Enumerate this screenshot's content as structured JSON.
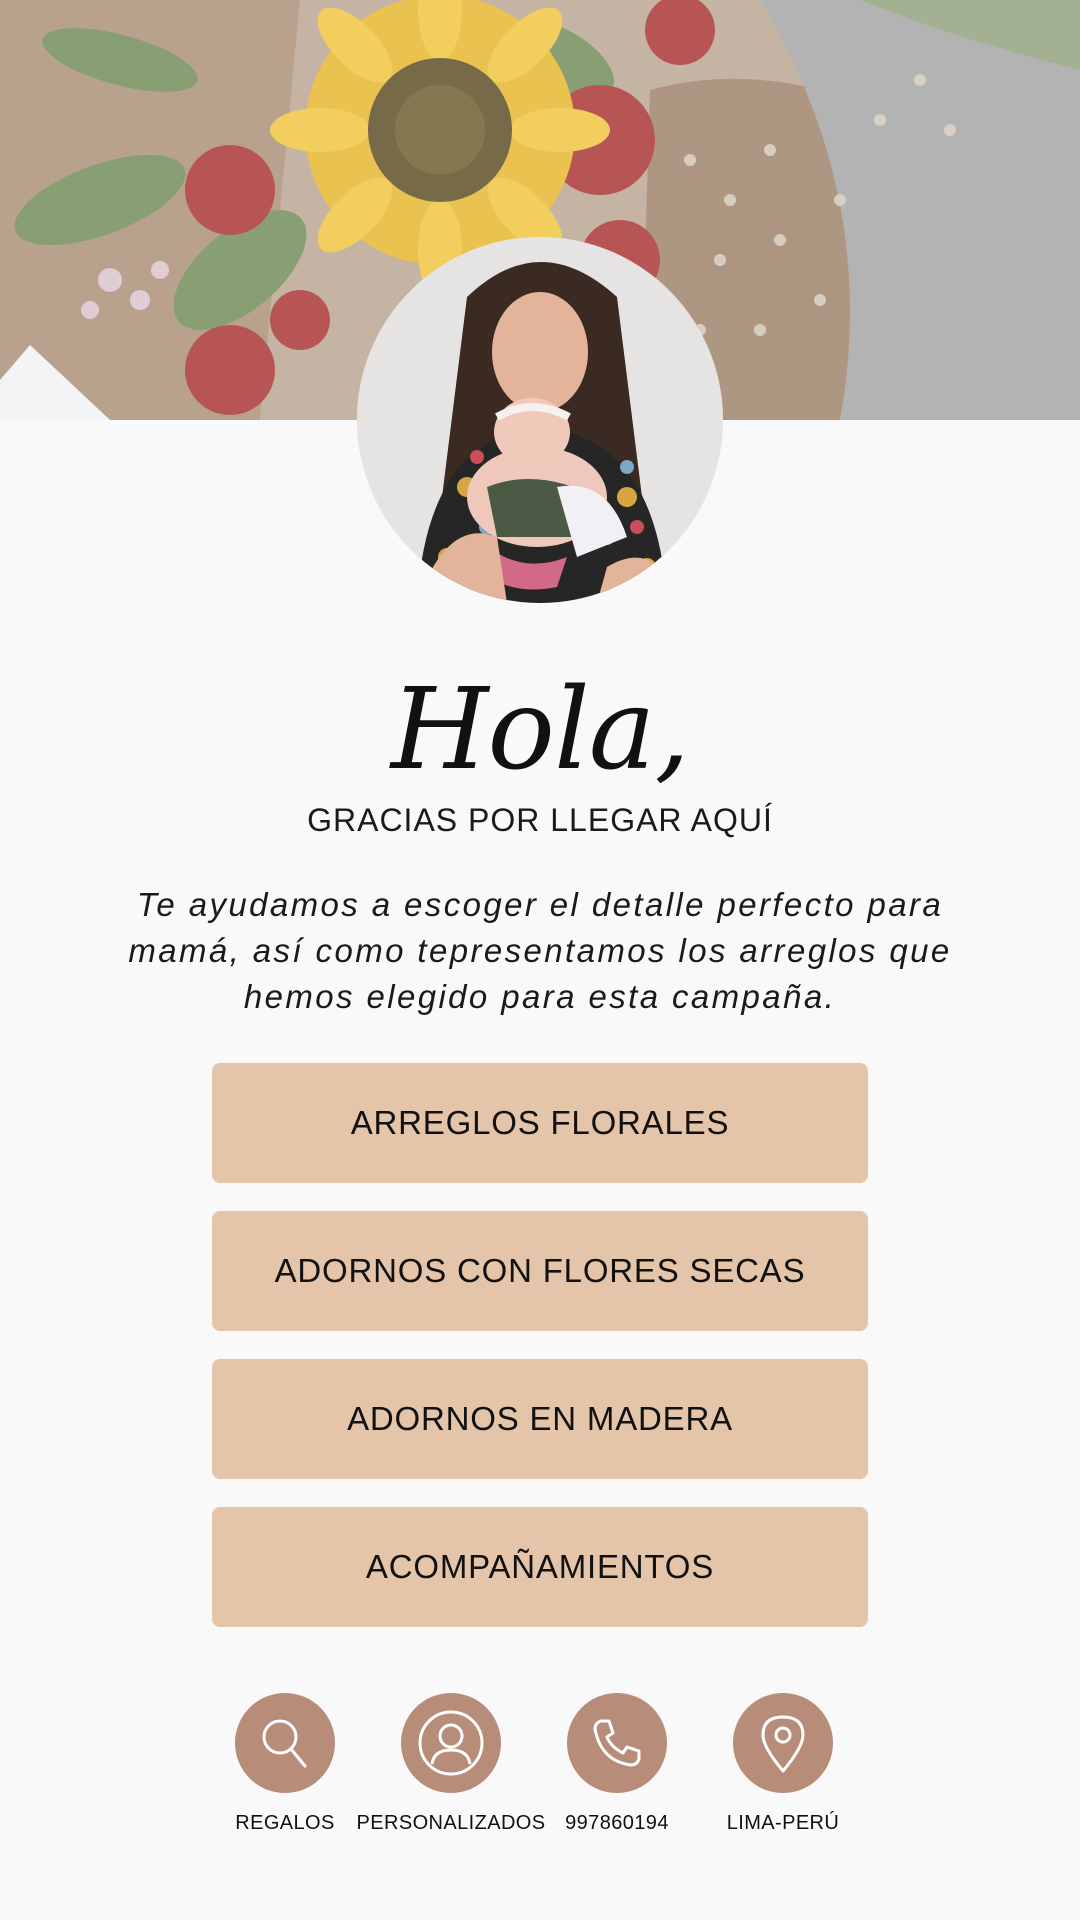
{
  "header": {
    "banner_image": "sunflower-bouquet-photo",
    "avatar_image": "mother-holding-newborn-photo"
  },
  "greeting": "Hola,",
  "subtitle": "GRACIAS POR LLEGAR AQUÍ",
  "intro": "Te ayudamos a escoger el detalle perfecto para mamá, así como tepresentamos los arreglos que hemos elegido para esta campaña.",
  "menu": {
    "items": [
      {
        "label": "ARREGLOS FLORALES"
      },
      {
        "label": "ADORNOS CON FLORES SECAS"
      },
      {
        "label": "ADORNOS EN MADERA"
      },
      {
        "label": "ACOMPAÑAMIENTOS"
      }
    ]
  },
  "footer": {
    "links": [
      {
        "label": "REGALOS",
        "icon": "search-icon"
      },
      {
        "label": "PERSONALIZADOS",
        "icon": "user-icon"
      },
      {
        "label": "997860194",
        "icon": "phone-icon"
      },
      {
        "label": "LIMA-PERÚ",
        "icon": "location-pin-icon"
      }
    ]
  },
  "colors": {
    "background": "#f9f9f9",
    "button": "#e4c5a9",
    "icon_circle": "#b78c78",
    "text": "#111111"
  }
}
